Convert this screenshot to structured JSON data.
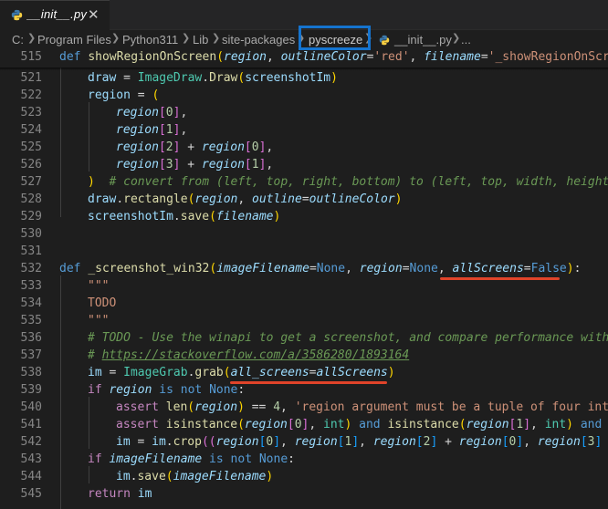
{
  "tab": {
    "label": "__init__.py",
    "close_icon": "close-icon",
    "file_icon": "python-file-icon"
  },
  "breadcrumb": {
    "items": [
      "C:",
      "Program Files",
      "Python311",
      "Lib",
      "site-packages",
      "pyscreeze",
      "__init__.py",
      "..."
    ],
    "highlight_color": "#1574cf"
  },
  "editor": {
    "line_numbers": [
      "515",
      "521",
      "522",
      "523",
      "524",
      "525",
      "526",
      "527",
      "528",
      "529",
      "530",
      "531",
      "532",
      "533",
      "534",
      "535",
      "536",
      "537",
      "538",
      "539",
      "540",
      "541",
      "542",
      "543",
      "544",
      "545"
    ],
    "annotation_color": "#e0442a",
    "lines": {
      "l515": {
        "kw": "def ",
        "fn": "showRegionOnScreen",
        "p1": "(",
        "a1": "region",
        "c1": ", ",
        "a2": "outlineColor",
        "eq1": "=",
        "s1": "'red'",
        "c2": ", ",
        "a3": "filename",
        "eq2": "=",
        "s2": "'_showRegionOnScre"
      },
      "l521": {
        "a": "draw",
        "op": " = ",
        "cls": "ImageDraw",
        "dot": ".",
        "fn": "Draw",
        "p1": "(",
        "arg": "screenshotIm",
        "p2": ")"
      },
      "l522": {
        "a": "region",
        "op": " = ",
        "p": "("
      },
      "l523": {
        "a": "region",
        "b1": "[",
        "n": "0",
        "b2": "]",
        "t": ","
      },
      "l524": {
        "a": "region",
        "b1": "[",
        "n": "1",
        "b2": "]",
        "t": ","
      },
      "l525": {
        "a": "region",
        "b1": "[",
        "n": "2",
        "b2": "]",
        "op": " + ",
        "a2": "region",
        "b3": "[",
        "n2": "0",
        "b4": "]",
        "t": ","
      },
      "l526": {
        "a": "region",
        "b1": "[",
        "n": "3",
        "b2": "]",
        "op": " + ",
        "a2": "region",
        "b3": "[",
        "n2": "1",
        "b4": "]",
        "t": ","
      },
      "l527": {
        "p": ")",
        "cmt": "  # convert from (left, top, right, bottom) to (left, top, width, height)"
      },
      "l528": {
        "a": "draw",
        "dot": ".",
        "fn": "rectangle",
        "p1": "(",
        "arg": "region",
        "c": ", ",
        "kw": "outline",
        "eq": "=",
        "val": "outlineColor",
        "p2": ")"
      },
      "l529": {
        "a": "screenshotIm",
        "dot": ".",
        "fn": "save",
        "p1": "(",
        "arg": "filename",
        "p2": ")"
      },
      "l532": {
        "kw": "def ",
        "fn": "_screenshot_win32",
        "p1": "(",
        "a1": "imageFilename",
        "eq1": "=",
        "v1": "None",
        "c1": ", ",
        "a2": "region",
        "eq2": "=",
        "v2": "None",
        "c2": ", ",
        "a3": "allScreens",
        "eq3": "=",
        "v3": "False",
        "p2": ")",
        "colon": ":"
      },
      "l533": {
        "s": "\"\"\""
      },
      "l534": {
        "s": "TODO"
      },
      "l535": {
        "s": "\"\"\""
      },
      "l536": {
        "cmt": "# TODO - Use the winapi to get a screenshot, and compare performance with"
      },
      "l537": {
        "cmt": "# ",
        "url": "https://stackoverflow.com/a/3586280/1893164"
      },
      "l538": {
        "a": "im",
        "op": " = ",
        "cls": "ImageGrab",
        "dot": ".",
        "fn": "grab",
        "p1": "(",
        "kw": "all_screens",
        "eq": "=",
        "val": "allScreens",
        "p2": ")"
      },
      "l539": {
        "kw": "if ",
        "a": "region",
        "rest": " is ",
        "kw2": "not ",
        "v": "None",
        "colon": ":"
      },
      "l540": {
        "kw": "assert ",
        "fn": "len",
        "p1": "(",
        "a": "region",
        "p2": ")",
        "op": " == ",
        "n": "4",
        "c": ", ",
        "s": "'region argument must be a tuple of four ints"
      },
      "l541": {
        "kw": "assert ",
        "fn": "isinstance",
        "p1": "(",
        "a": "region",
        "b1": "[",
        "n": "0",
        "b2": "]",
        "c": ", ",
        "cls": "int",
        "p2": ")",
        "and": " and ",
        "fn2": "isinstance",
        "p3": "(",
        "a2": "region",
        "b3": "[",
        "n2": "1",
        "b4": "]",
        "c2": ", ",
        "cls2": "int",
        "p4": ")",
        "and2": " and i"
      },
      "l542": {
        "a": "im",
        "op": " = ",
        "a2": "im",
        "dot": ".",
        "fn": "crop",
        "p1": "((",
        "a3": "region",
        "b1": "[",
        "n": "0",
        "b2": "]",
        "c1": ", ",
        "a4": "region",
        "b3": "[",
        "n2": "1",
        "b4": "]",
        "c2": ", ",
        "a5": "region",
        "b5": "[",
        "n3": "2",
        "b6": "]",
        "op2": " + ",
        "a6": "region",
        "b7": "[",
        "n4": "0",
        "b8": "]",
        "c3": ", ",
        "a7": "region",
        "b9": "[",
        "n5": "3",
        "b10": "]",
        "tail": " +"
      },
      "l543": {
        "kw": "if ",
        "a": "imageFilename",
        "rest": " is ",
        "kw2": "not ",
        "v": "None",
        "colon": ":"
      },
      "l544": {
        "a": "im",
        "dot": ".",
        "fn": "save",
        "p1": "(",
        "arg": "imageFilename",
        "p2": ")"
      },
      "l545": {
        "kw": "return ",
        "a": "im"
      }
    }
  }
}
